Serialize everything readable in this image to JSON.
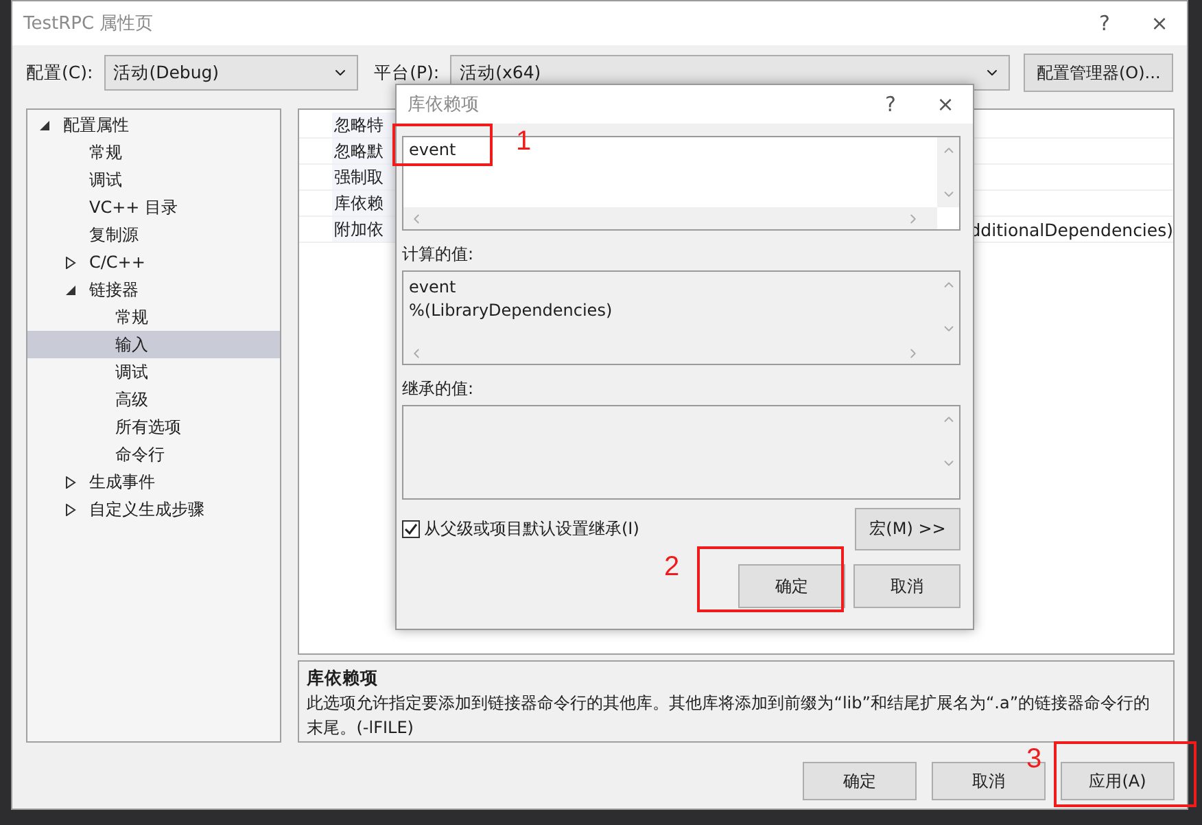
{
  "window": {
    "title": "TestRPC 属性页",
    "help": "?",
    "close": "×"
  },
  "config": {
    "label": "配置(C):",
    "value": "活动(Debug)"
  },
  "platform": {
    "label": "平台(P):",
    "value": "活动(x64)"
  },
  "config_manager_button": "配置管理器(O)...",
  "tree": [
    {
      "label": "配置属性",
      "expanded": true,
      "selected": false,
      "children": [
        {
          "label": "常规",
          "selected": false
        },
        {
          "label": "调试",
          "selected": false
        },
        {
          "label": "VC++ 目录",
          "selected": false
        },
        {
          "label": "复制源",
          "selected": false
        },
        {
          "label": "C/C++",
          "expanded": false,
          "selected": false
        },
        {
          "label": "链接器",
          "expanded": true,
          "selected": false,
          "children": [
            {
              "label": "常规",
              "selected": false
            },
            {
              "label": "输入",
              "selected": true
            },
            {
              "label": "调试",
              "selected": false
            },
            {
              "label": "高级",
              "selected": false
            },
            {
              "label": "所有选项",
              "selected": false
            },
            {
              "label": "命令行",
              "selected": false
            }
          ]
        },
        {
          "label": "生成事件",
          "expanded": false,
          "selected": false
        },
        {
          "label": "自定义生成步骤",
          "expanded": false,
          "selected": false
        }
      ]
    }
  ],
  "properties": [
    {
      "name": "忽略特"
    },
    {
      "name": "忽略默"
    },
    {
      "name": "强制取"
    },
    {
      "name": "库依赖"
    },
    {
      "name": "附加依",
      "value": "dditionalDependencies)"
    }
  ],
  "description": {
    "title": "库依赖项",
    "text": "此选项允许指定要添加到链接器命令行的其他库。其他库将添加到前缀为“lib”和结尾扩展名为“.a”的链接器命令行的末尾。(-lFILE)"
  },
  "buttons": [
    "确定",
    "取消",
    "应用(A)"
  ],
  "dialog": {
    "title": "库依赖项",
    "help": "?",
    "close": "×",
    "value": "event",
    "computed_label": "计算的值:",
    "computed_lines": [
      "event",
      "%(LibraryDependencies)"
    ],
    "inherited_label": "继承的值:",
    "inherit": {
      "label": "从父级或项目默认设置继承(I)",
      "checked": true
    },
    "macro_button": "宏(M) >>",
    "buttons": [
      "确定",
      "取消"
    ]
  },
  "annotations": [
    {
      "label": "1"
    },
    {
      "label": "2"
    },
    {
      "label": "3"
    }
  ]
}
